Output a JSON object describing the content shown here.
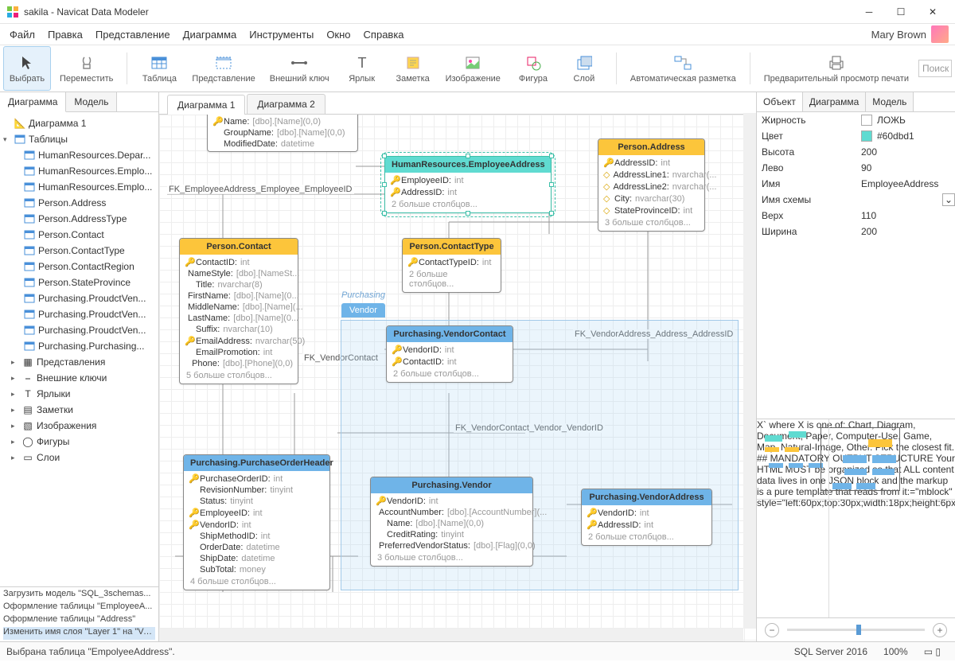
{
  "window": {
    "title": "sakila - Navicat Data Modeler"
  },
  "menu": [
    "Файл",
    "Правка",
    "Представление",
    "Диаграмма",
    "Инструменты",
    "Окно",
    "Справка"
  ],
  "user": {
    "name": "Mary Brown"
  },
  "toolbar": [
    {
      "id": "select",
      "label": "Выбрать",
      "active": true
    },
    {
      "id": "move",
      "label": "Переместить"
    },
    {
      "sep": true
    },
    {
      "id": "table",
      "label": "Таблица"
    },
    {
      "id": "view",
      "label": "Представление"
    },
    {
      "id": "fk",
      "label": "Внешний ключ"
    },
    {
      "id": "label",
      "label": "Ярлык"
    },
    {
      "id": "note",
      "label": "Заметка"
    },
    {
      "id": "image",
      "label": "Изображение"
    },
    {
      "id": "shape",
      "label": "Фигура"
    },
    {
      "id": "layer",
      "label": "Слой"
    },
    {
      "sep": true
    },
    {
      "id": "autolayout",
      "label": "Автоматическая разметка"
    },
    {
      "sep": true
    },
    {
      "id": "printpreview",
      "label": "Предварительный просмотр печати"
    }
  ],
  "search_placeholder": "Поиск",
  "left_tabs": [
    "Диаграмма",
    "Модель"
  ],
  "tree": {
    "root": "Диаграмма 1",
    "tables_label": "Таблицы",
    "tables": [
      "HumanResources.Depar...",
      "HumanResources.Emplo...",
      "HumanResources.Emplo...",
      "Person.Address",
      "Person.AddressType",
      "Person.Contact",
      "Person.ContactType",
      "Person.ContactRegion",
      "Person.StateProvince",
      "Purchasing.ProudctVen...",
      "Purchasing.ProudctVen...",
      "Purchasing.ProudctVen...",
      "Purchasing.Purchasing..."
    ],
    "cats": [
      {
        "label": "Представления",
        "icon": "view"
      },
      {
        "label": "Внешние ключи",
        "icon": "fk"
      },
      {
        "label": "Ярлыки",
        "icon": "label"
      },
      {
        "label": "Заметки",
        "icon": "note"
      },
      {
        "label": "Изображения",
        "icon": "image"
      },
      {
        "label": "Фигуры",
        "icon": "shape"
      },
      {
        "label": "Слои",
        "icon": "layer"
      }
    ]
  },
  "log": [
    "Загрузить модель \"SQL_3schemas...",
    "Оформление таблицы \"EmployeeA...",
    "Оформление таблицы \"Address\"",
    "Изменить имя слоя \"Layer 1\" на \"Ve..."
  ],
  "center_tabs": [
    "Диаграмма 1",
    "Диаграмма 2"
  ],
  "layer": {
    "tab": "Vendor",
    "label": "Purchasing"
  },
  "rel_labels": {
    "r1": "FK_EmployeeAddress_Employee_EmployeeID",
    "r2": "FK_VendorAddress_Address_AddressID",
    "r3": "FK_VendorContact",
    "r4": "FK_VendorContact_Vendor_VendorID"
  },
  "entities": {
    "dept": {
      "title": "",
      "rows": [
        {
          "pk": true,
          "d": true,
          "name": "Name:",
          "type": "[dbo].[Name](0,0)"
        },
        {
          "name": "GroupName:",
          "type": "[dbo].[Name](0,0)"
        },
        {
          "name": "ModifiedDate:",
          "type": "datetime"
        }
      ]
    },
    "empaddr": {
      "title": "HumanResources.EmployeeAddress",
      "rows": [
        {
          "pk": true,
          "name": "EmployeeID:",
          "type": "int"
        },
        {
          "pk": true,
          "name": "AddressID:",
          "type": "int"
        }
      ],
      "more": "2 больше столбцов..."
    },
    "address": {
      "title": "Person.Address",
      "rows": [
        {
          "pk": true,
          "name": "AddressID:",
          "type": "int"
        },
        {
          "d": true,
          "name": "AddressLine1:",
          "type": "nvarchar(..."
        },
        {
          "d": true,
          "name": "AddressLine2:",
          "type": "nvarchar(..."
        },
        {
          "d": true,
          "name": "City:",
          "type": "nvarchar(30)"
        },
        {
          "d": true,
          "name": "StateProvinceID:",
          "type": "int"
        }
      ],
      "more": "3 больше столбцов..."
    },
    "contact": {
      "title": "Person.Contact",
      "rows": [
        {
          "pk": true,
          "name": "ContactID:",
          "type": "int"
        },
        {
          "name": "NameStyle:",
          "type": "[dbo].[NameSt..."
        },
        {
          "name": "Title:",
          "type": "nvarchar(8)"
        },
        {
          "name": "FirstName:",
          "type": "[dbo].[Name](0..."
        },
        {
          "name": "MiddleName:",
          "type": "[dbo].[Name](..."
        },
        {
          "name": "LastName:",
          "type": "[dbo].[Name](0..."
        },
        {
          "name": "Suffix:",
          "type": "nvarchar(10)"
        },
        {
          "pk": true,
          "name": "EmailAddress:",
          "type": "nvarchar(50)"
        },
        {
          "name": "EmailPromotion:",
          "type": "int"
        },
        {
          "name": "Phone:",
          "type": "[dbo].[Phone](0,0)"
        }
      ],
      "more": "5 больше столбцов..."
    },
    "contacttype": {
      "title": "Person.ContactType",
      "rows": [
        {
          "pk": true,
          "name": "ContactTypeID:",
          "type": "int"
        }
      ],
      "more": "2 больше столбцов..."
    },
    "vendorcontact": {
      "title": "Purchasing.VendorContact",
      "rows": [
        {
          "pk": true,
          "name": "VendorID:",
          "type": "int"
        },
        {
          "pk": true,
          "name": "ContactID:",
          "type": "int"
        }
      ],
      "more": "2 больше столбцов..."
    },
    "poh": {
      "title": "Purchasing.PurchaseOrderHeader",
      "rows": [
        {
          "pk": true,
          "name": "PurchaseOrderID:",
          "type": "int"
        },
        {
          "name": "RevisionNumber:",
          "type": "tinyint"
        },
        {
          "name": "Status:",
          "type": "tinyint"
        },
        {
          "pk": true,
          "name": "EmployeeID:",
          "type": "int"
        },
        {
          "pk": true,
          "name": "VendorID:",
          "type": "int"
        },
        {
          "name": "ShipMethodID:",
          "type": "int"
        },
        {
          "name": "OrderDate:",
          "type": "datetime"
        },
        {
          "name": "ShipDate:",
          "type": "datetime"
        },
        {
          "name": "SubTotal:",
          "type": "money"
        }
      ],
      "more": "4 больше столбцов..."
    },
    "vendor": {
      "title": "Purchasing.Vendor",
      "rows": [
        {
          "pk": true,
          "name": "VendorID:",
          "type": "int"
        },
        {
          "name": "AccountNumber:",
          "type": "[dbo].[AccountNumber](..."
        },
        {
          "name": "Name:",
          "type": "[dbo].[Name](0,0)"
        },
        {
          "name": "CreditRating:",
          "type": "tinyint"
        },
        {
          "name": "PreferredVendorStatus:",
          "type": "[dbo].[Flag](0,0)"
        }
      ],
      "more": "3 больше столбцов..."
    },
    "vendoraddr": {
      "title": "Purchasing.VendorAddress",
      "rows": [
        {
          "pk": true,
          "name": "VendorID:",
          "type": "int"
        },
        {
          "pk": true,
          "name": "AddressID:",
          "type": "int"
        }
      ],
      "more": "2 больше столбцов..."
    }
  },
  "right_tabs": [
    "Объект",
    "Диаграмма",
    "Модель"
  ],
  "props": [
    {
      "k": "Жирность",
      "v": "ЛОЖЬ",
      "check": true
    },
    {
      "k": "Цвет",
      "v": "#60dbd1",
      "swatch": "#60dbd1"
    },
    {
      "k": "Высота",
      "v": "200"
    },
    {
      "k": "Лево",
      "v": "90"
    },
    {
      "k": "Имя",
      "v": "EmployeeAddress"
    },
    {
      "k": "Имя схемы",
      "v": "",
      "combo": true
    },
    {
      "k": "Верх",
      "v": "110"
    },
    {
      "k": "Ширина",
      "v": "200"
    }
  ],
  "status": {
    "msg": "Выбрана таблица \"EmpolyeeAddress\".",
    "db": "SQL Server 2016",
    "zoom": "100%"
  }
}
